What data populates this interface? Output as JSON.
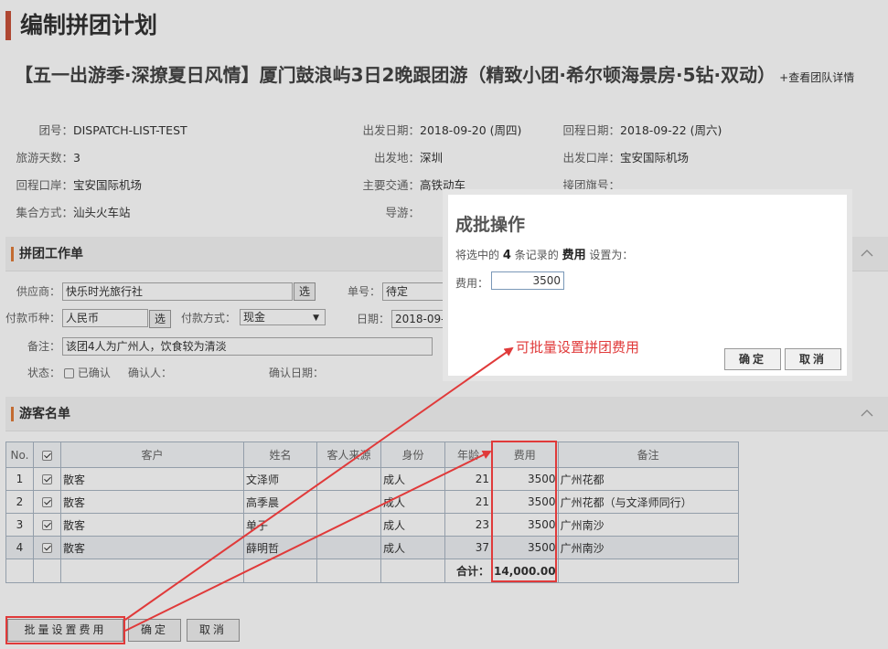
{
  "page_title": "编制拼团计划",
  "trip": {
    "title": "【五一出游季·深撩夏日风情】厦门鼓浪屿3日2晚跟团游（精致小团·希尔顿海景房·5钻·双动）",
    "detail_link": "+查看团队详情"
  },
  "info": {
    "group_no_label": "团号：",
    "group_no": "DISPATCH-LIST-TEST",
    "depart_date_label": "出发日期：",
    "depart_date": "2018-09-20 (周四)",
    "return_date_label": "回程日期：",
    "return_date": "2018-09-22 (周六)",
    "days_label": "旅游天数：",
    "days": "3",
    "origin_label": "出发地：",
    "origin": "深圳",
    "depart_port_label": "出发口岸：",
    "depart_port": "宝安国际机场",
    "return_port_label": "回程口岸：",
    "return_port": "宝安国际机场",
    "transport_label": "主要交通：",
    "transport": "高铁动车",
    "flag_label": "接团旗号：",
    "flag": "",
    "gather_label": "集合方式：",
    "gather": "汕头火车站",
    "guide_label": "导游：",
    "guide": ""
  },
  "work_section": {
    "title": "拼团工作单",
    "supplier_label": "供应商：",
    "supplier": "快乐时光旅行社",
    "select_label": "选",
    "order_no_label": "单号：",
    "order_no": "待定",
    "currency_label": "付款币种：",
    "currency": "人民币",
    "pay_method_label": "付款方式：",
    "pay_method": "现金",
    "date_label": "日期：",
    "date": "2018-09-1",
    "remark_label": "备注：",
    "remark": "该团4人为广州人，饮食较为清淡",
    "status_label": "状态：",
    "confirmed_label": "已确认",
    "confirmer_label": "确认人：",
    "confirm_date_label": "确认日期："
  },
  "guest_section": {
    "title": "游客名单",
    "columns": [
      "No.",
      "",
      "客户",
      "姓名",
      "客人来源",
      "身份",
      "年龄",
      "费用",
      "备注"
    ],
    "rows": [
      {
        "no": "1",
        "customer": "散客",
        "name": "文泽师",
        "source": "",
        "role": "成人",
        "age": "21",
        "fee": "3500",
        "remark": "广州花都"
      },
      {
        "no": "2",
        "customer": "散客",
        "name": "高季晨",
        "source": "",
        "role": "成人",
        "age": "21",
        "fee": "3500",
        "remark": "广州花都（与文泽师同行）"
      },
      {
        "no": "3",
        "customer": "散客",
        "name": "单子",
        "source": "",
        "role": "成人",
        "age": "23",
        "fee": "3500",
        "remark": "广州南沙"
      },
      {
        "no": "4",
        "customer": "散客",
        "name": "薛明哲",
        "source": "",
        "role": "成人",
        "age": "37",
        "fee": "3500",
        "remark": "广州南沙"
      }
    ],
    "total_label": "合计：",
    "total": "14,000.00"
  },
  "buttons": {
    "batch_fee": "批量设置费用",
    "confirm": "确定",
    "cancel": "取消"
  },
  "dialog": {
    "title": "成批操作",
    "msg_prefix": "将选中的",
    "count": "4",
    "msg_mid": "条记录的",
    "field": "费用",
    "msg_suffix": "设置为：",
    "fee_label": "费用：",
    "fee_value": "3500",
    "confirm": "确定",
    "cancel": "取消"
  },
  "annotation": "可批量设置拼团费用",
  "colors": {
    "accent": "#c9523a",
    "section_marker": "#e07b39",
    "annotation_red": "#e03a3a"
  }
}
